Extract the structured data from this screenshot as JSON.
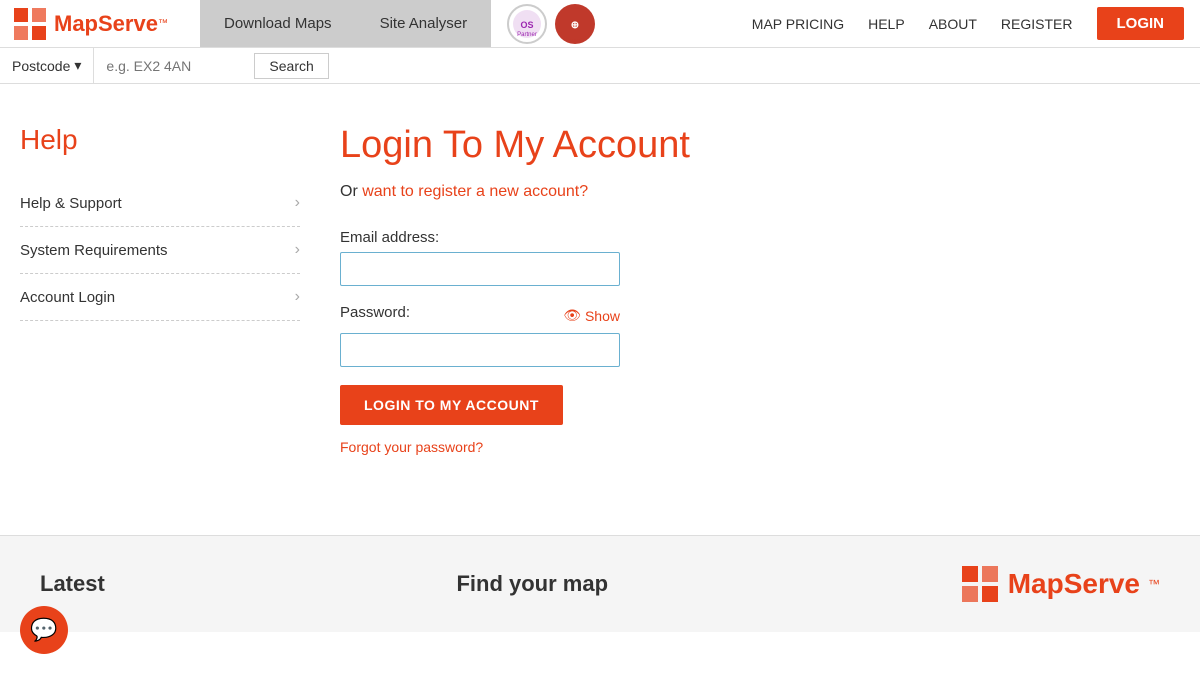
{
  "header": {
    "logo_text": "MapServe",
    "logo_tm": "™",
    "nav_tabs": [
      {
        "id": "download-maps",
        "label": "Download Maps"
      },
      {
        "id": "site-analyser",
        "label": "Site Analyser"
      }
    ],
    "nav_links": [
      {
        "id": "map-pricing",
        "label": "MAP PRICING"
      },
      {
        "id": "help",
        "label": "HELP"
      },
      {
        "id": "about",
        "label": "ABOUT"
      },
      {
        "id": "register",
        "label": "REGISTER"
      }
    ],
    "login_btn": "LOGIN"
  },
  "search_bar": {
    "dropdown_label": "Postcode",
    "input_placeholder": "e.g. EX2 4AN",
    "search_btn": "Search"
  },
  "sidebar": {
    "title": "Help",
    "items": [
      {
        "id": "help-support",
        "label": "Help & Support"
      },
      {
        "id": "system-requirements",
        "label": "System Requirements"
      },
      {
        "id": "account-login",
        "label": "Account Login"
      }
    ]
  },
  "main": {
    "page_title": "Login To My Account",
    "register_prompt_text": "Or ",
    "register_link": "want to register a new account?",
    "email_label": "Email address:",
    "password_label": "Password:",
    "show_label": "Show",
    "submit_btn": "LOGIN TO MY ACCOUNT",
    "forgot_link": "Forgot your password?"
  },
  "footer": {
    "latest_label": "Latest",
    "find_label": "Find your map",
    "logo_text": "MapServe",
    "logo_tm": "™"
  },
  "chat": {
    "icon": "💬"
  }
}
